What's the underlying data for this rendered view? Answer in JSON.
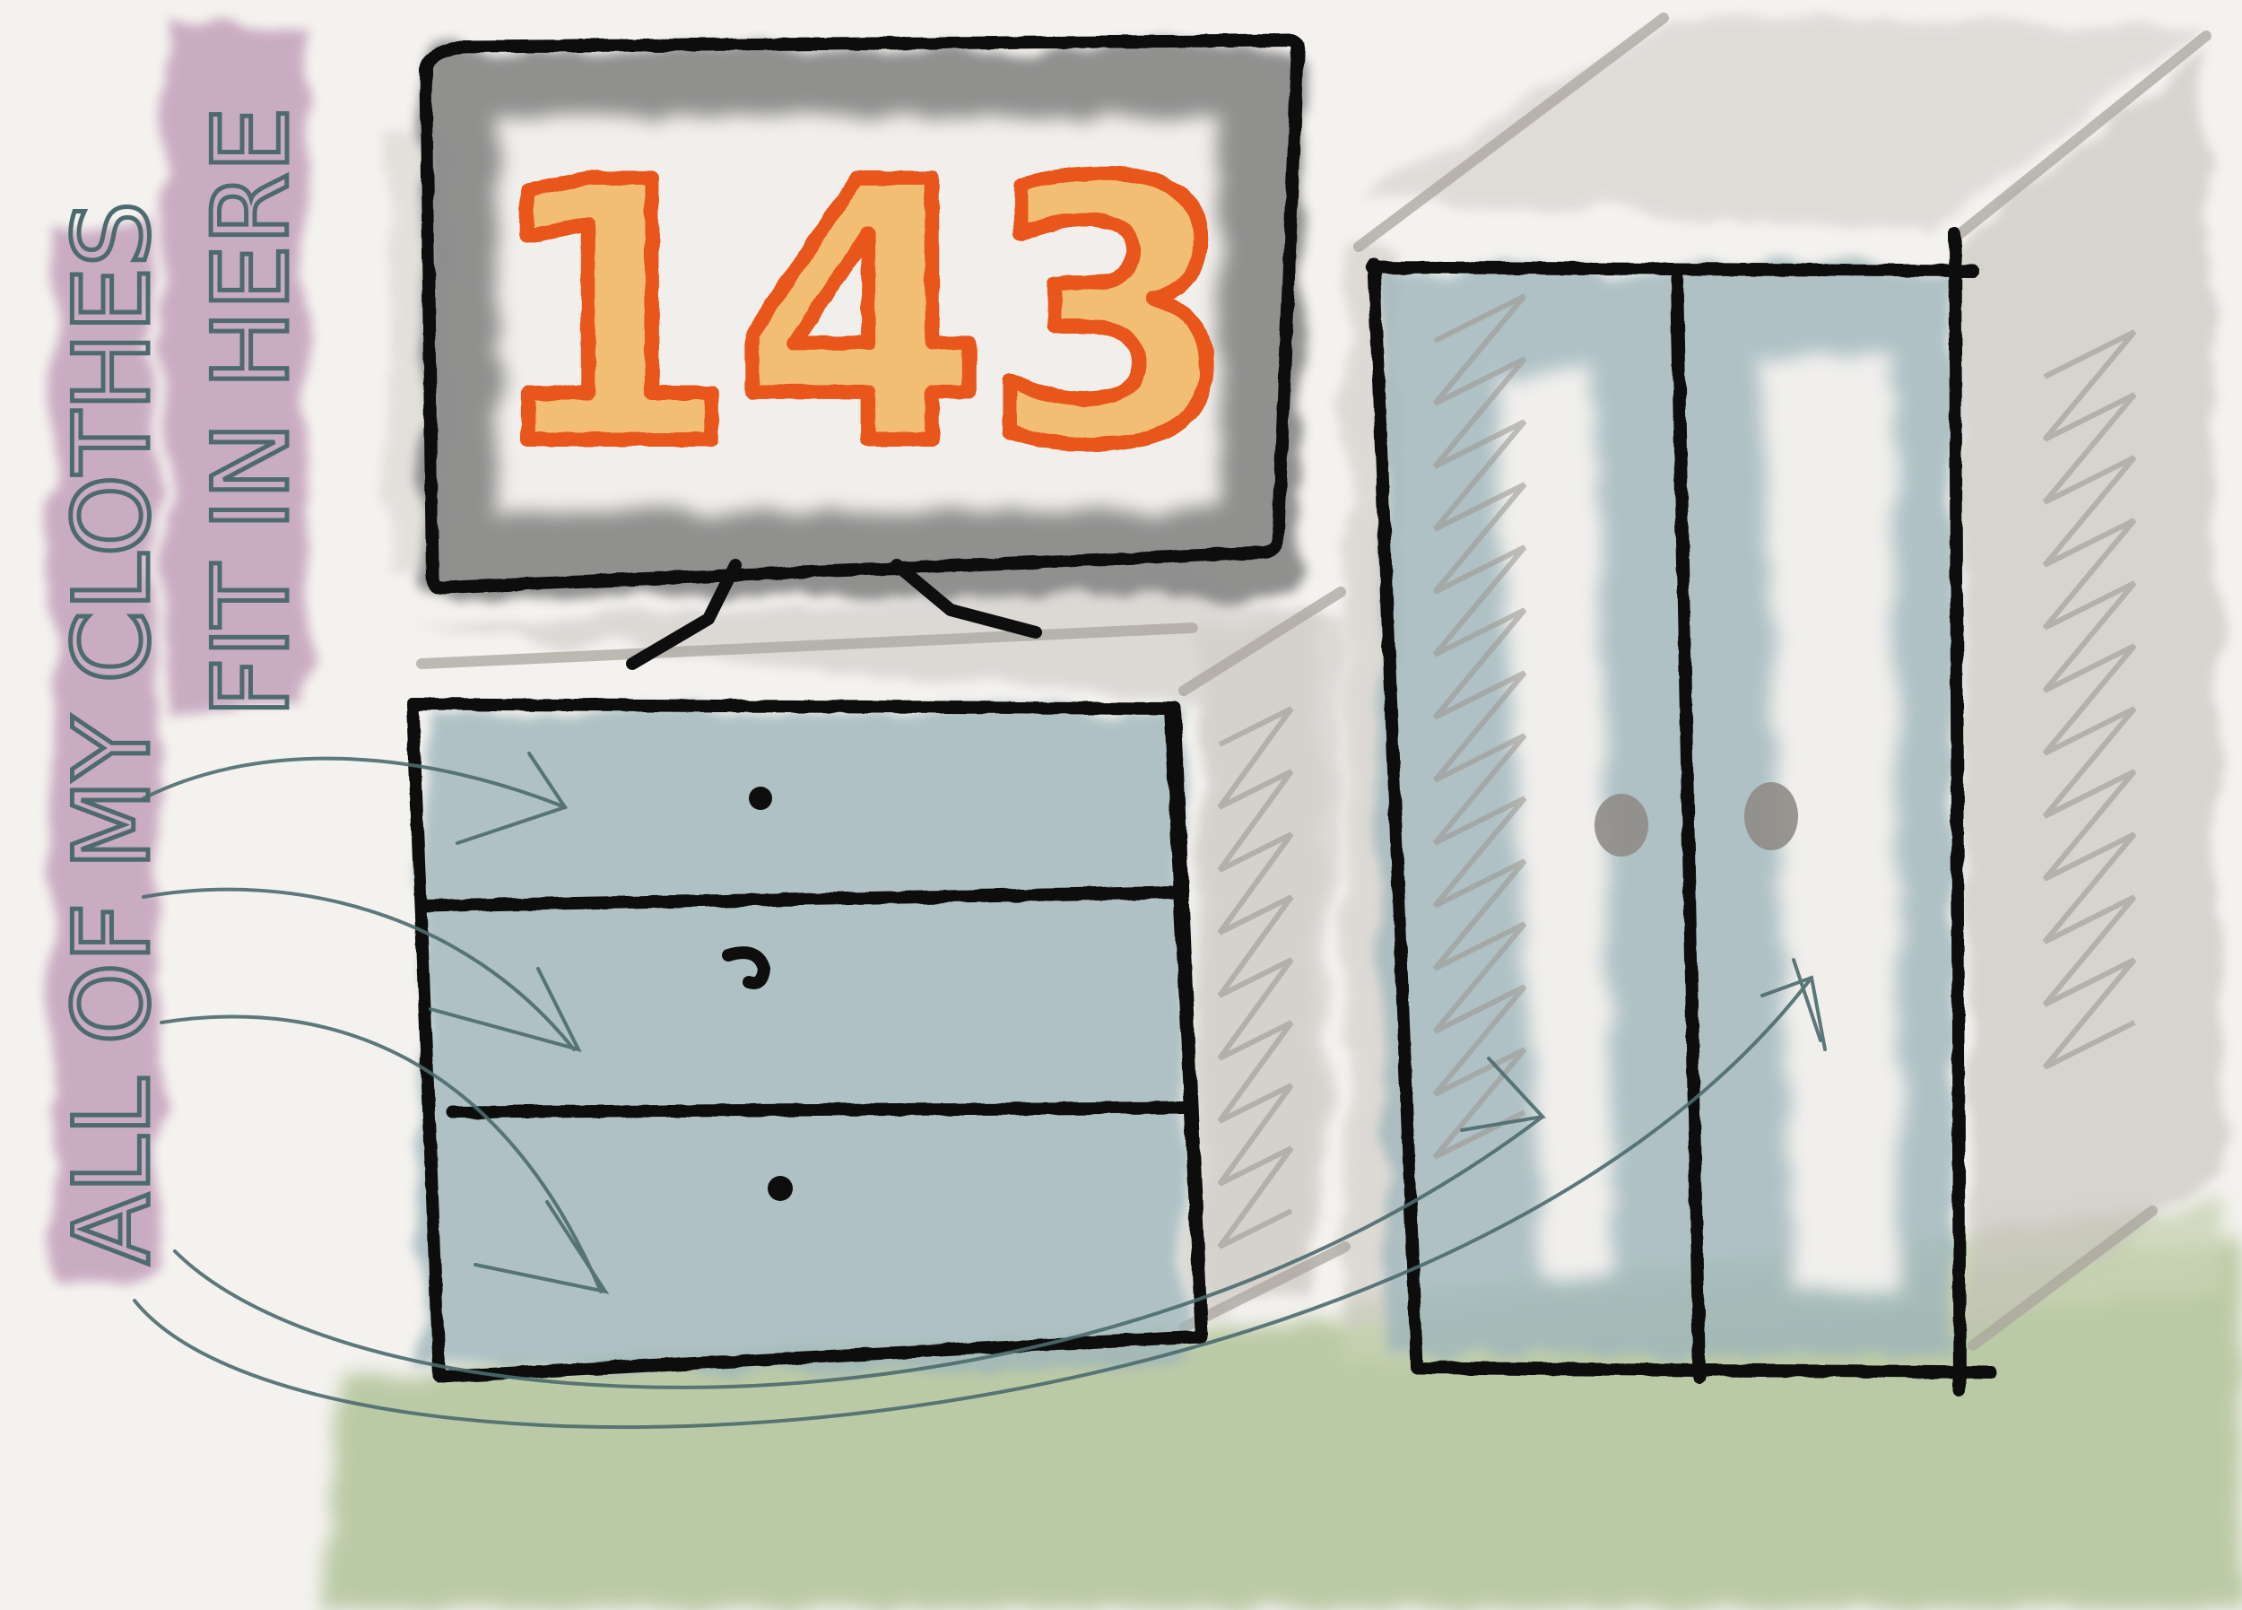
{
  "tv": {
    "number": "143"
  },
  "note": {
    "line1": "ALL OF MY CLOTHES",
    "line2": "FIT IN HERE"
  },
  "colors": {
    "paper": "#f4f2ef",
    "ink": "#0e0e0e",
    "furniture_wash": "#9fb6bb",
    "label_highlight": "#b98fb0",
    "tv_frame_wash": "#7f7f7f",
    "number_orange": "#e8561a",
    "number_fill": "#f2ad4a",
    "floor_wash": "#a8bd8e",
    "wall_shadow": "#c9c6c1",
    "arrow_ink": "#4d6b6e"
  }
}
